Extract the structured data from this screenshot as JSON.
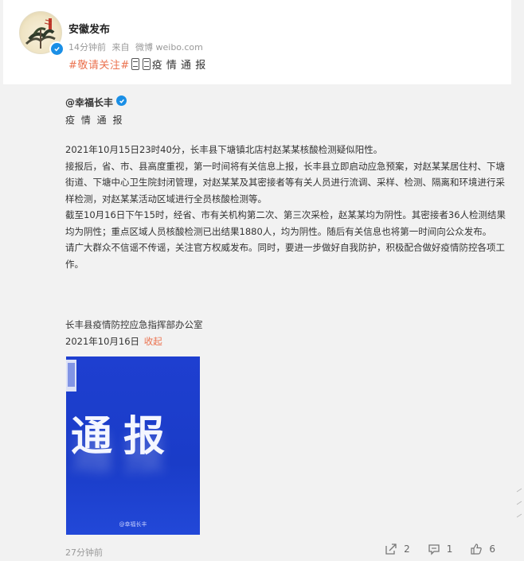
{
  "post": {
    "author": "安徽发布",
    "time_ago": "14分钟前",
    "source_prefix": "来自",
    "source": "微博 weibo.com",
    "tag": "#敬请关注#",
    "title": "疫 情 通 报"
  },
  "repost": {
    "author": "@幸福长丰",
    "title": "疫 情 通 报",
    "paragraphs": [
      "2021年10月15日23时40分，长丰县下塘镇北店村赵某某核酸检测疑似阳性。",
      "接报后，省、市、县高度重视，第一时间将有关信息上报，长丰县立即启动应急预案，对赵某某居住村、下塘街道、下塘中心卫生院封闭管理，对赵某某及其密接者等有关人员进行流调、采样、检测、隔离和环境进行采样检测，对赵某某活动区域进行全员核酸检测等。",
      "截至10月16日下午15时，经省、市有关机构第二次、第三次采检，赵某某均为阴性。其密接者36人检测结果均为阴性；重点区域人员核酸检测已出结果1880人，均为阴性。随后有关信息也将第一时间向公众发布。",
      "请广大群众不信谣不传谣，关注官方权威发布。同时，要进一步做好自我防护，积极配合做好疫情防控各项工作。"
    ],
    "signature": "长丰县疫情防控应急指挥部办公室",
    "date": "2021年10月16日",
    "collapse_label": "收起",
    "image": {
      "headline": "通报",
      "watermark": "@幸福长丰"
    },
    "time_ago": "27分钟前",
    "repost_count": "2",
    "comment_count": "1",
    "like_count": "6"
  },
  "colors": {
    "accent": "#eb7350",
    "verified": "#1a8fe6",
    "notice_blue": "#1e3fd0"
  },
  "icons": [
    "verified-icon",
    "mic-icon",
    "repost-icon",
    "comment-icon",
    "like-icon"
  ]
}
